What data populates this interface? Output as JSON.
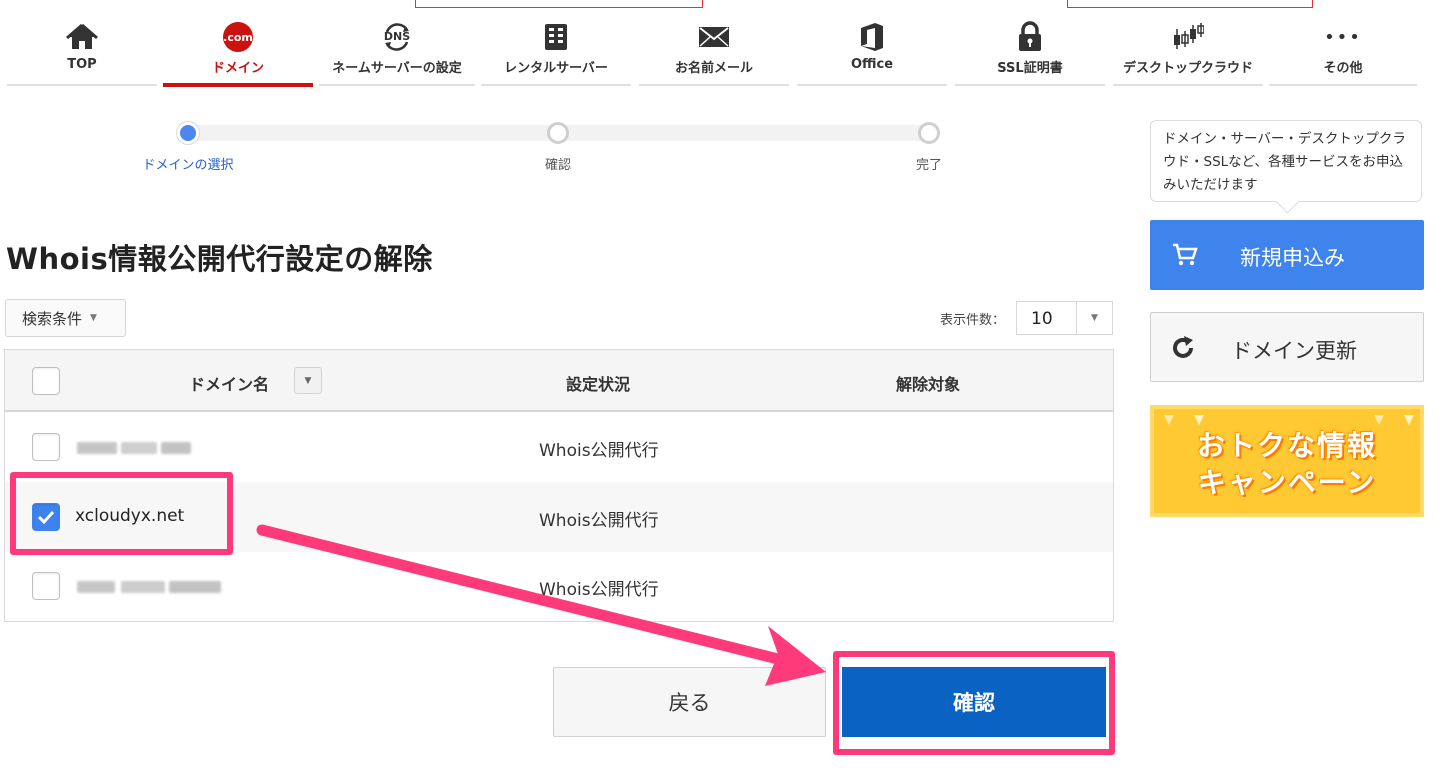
{
  "nav": {
    "items": [
      {
        "label": "TOP",
        "icon": "home-icon"
      },
      {
        "label": "ドメイン",
        "icon": "dotcom-icon",
        "badge": ".com",
        "active": true
      },
      {
        "label": "ネームサーバーの設定",
        "icon": "dns-icon",
        "badge": "DNS"
      },
      {
        "label": "レンタルサーバー",
        "icon": "server-icon"
      },
      {
        "label": "お名前メール",
        "icon": "mail-icon"
      },
      {
        "label": "Office",
        "icon": "office-icon"
      },
      {
        "label": "SSL証明書",
        "icon": "lock-icon"
      },
      {
        "label": "デスクトップクラウド",
        "icon": "chart-icon"
      },
      {
        "label": "その他",
        "icon": "more-icon",
        "glyph": "•••"
      }
    ]
  },
  "stepper": {
    "steps": [
      {
        "label": "ドメインの選択",
        "active": true
      },
      {
        "label": "確認",
        "active": false
      },
      {
        "label": "完了",
        "active": false
      }
    ]
  },
  "page": {
    "title": "Whois情報公開代行設定の解除"
  },
  "filters": {
    "search_label": "検索条件",
    "perpage_label": "表示件数：",
    "perpage_value": "10"
  },
  "table": {
    "headers": {
      "domain": "ドメイン名",
      "status": "設定状況",
      "target": "解除対象"
    },
    "rows": [
      {
        "domain": "",
        "status": "Whois公開代行",
        "checked": false,
        "blurred": true
      },
      {
        "domain": "xcloudyx.net",
        "status": "Whois公開代行",
        "checked": true,
        "blurred": false
      },
      {
        "domain": "",
        "status": "Whois公開代行",
        "checked": false,
        "blurred": true
      }
    ]
  },
  "actions": {
    "back_label": "戻る",
    "confirm_label": "確認"
  },
  "sidebar": {
    "tooltip": "ドメイン・サーバー・デスクトップクラウド・SSLなど、各種サービスをお申込みいただけます",
    "new_label": "新規申込み",
    "renew_label": "ドメイン更新",
    "banner_line1": "おトクな情報",
    "banner_line2": "キャンペーン"
  },
  "colors": {
    "accent_red": "#cc1111",
    "primary_blue": "#0a62c2",
    "sidebar_blue": "#3f83ec",
    "highlight_pink": "#ff3a7a",
    "banner_yellow": "#ffc934"
  }
}
